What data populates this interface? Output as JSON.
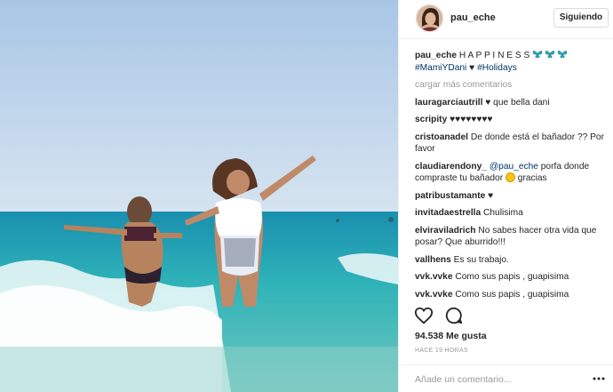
{
  "post": {
    "username": "pau_eche",
    "follow_label": "Siguiendo",
    "caption": {
      "user": "pau_eche",
      "text": "H A P P I N E S S",
      "hashtag1": "#MamiYDani",
      "hashtag2": "#Holidays"
    },
    "load_more": "cargar más comentarios",
    "comments": [
      {
        "user": "lauragarciautrill",
        "text": "♥ que bella dani"
      },
      {
        "user": "scripity",
        "text": "♥♥♥♥♥♥♥♥"
      },
      {
        "user": "cristoanadel",
        "text": "De donde está el bañador ?? Por favor"
      },
      {
        "user": "claudiarendony_",
        "mention": "@pau_eche",
        "text": "porfa donde compraste tu bañador",
        "text_after": "gracias"
      },
      {
        "user": "patribustamante",
        "text": "♥"
      },
      {
        "user": "invitadaestrella",
        "text": "Chulisima"
      },
      {
        "user": "elviraviladrich",
        "text": "No sabes hacer otra vida que posar? Que aburrido!!!"
      },
      {
        "user": "vallhens",
        "text": "Es su trabajo."
      },
      {
        "user": "vvk.vvke",
        "text": "Como sus papis , guapisima"
      },
      {
        "user": "vvk.vvke",
        "text": "Como sus papis , guapisima"
      }
    ],
    "likes": "94.538 Me gusta",
    "time": "HACE 19 HORAS",
    "add_comment_placeholder": "Añade un comentario...",
    "icons": {
      "like": "heart-icon",
      "comment": "comment-bubble-icon",
      "more": "more-options-icon",
      "caption_emoji": "butterfly-icon"
    },
    "colors": {
      "link": "#003569",
      "accent": "#3897f0",
      "muted": "#999999",
      "border": "#efefef"
    }
  }
}
